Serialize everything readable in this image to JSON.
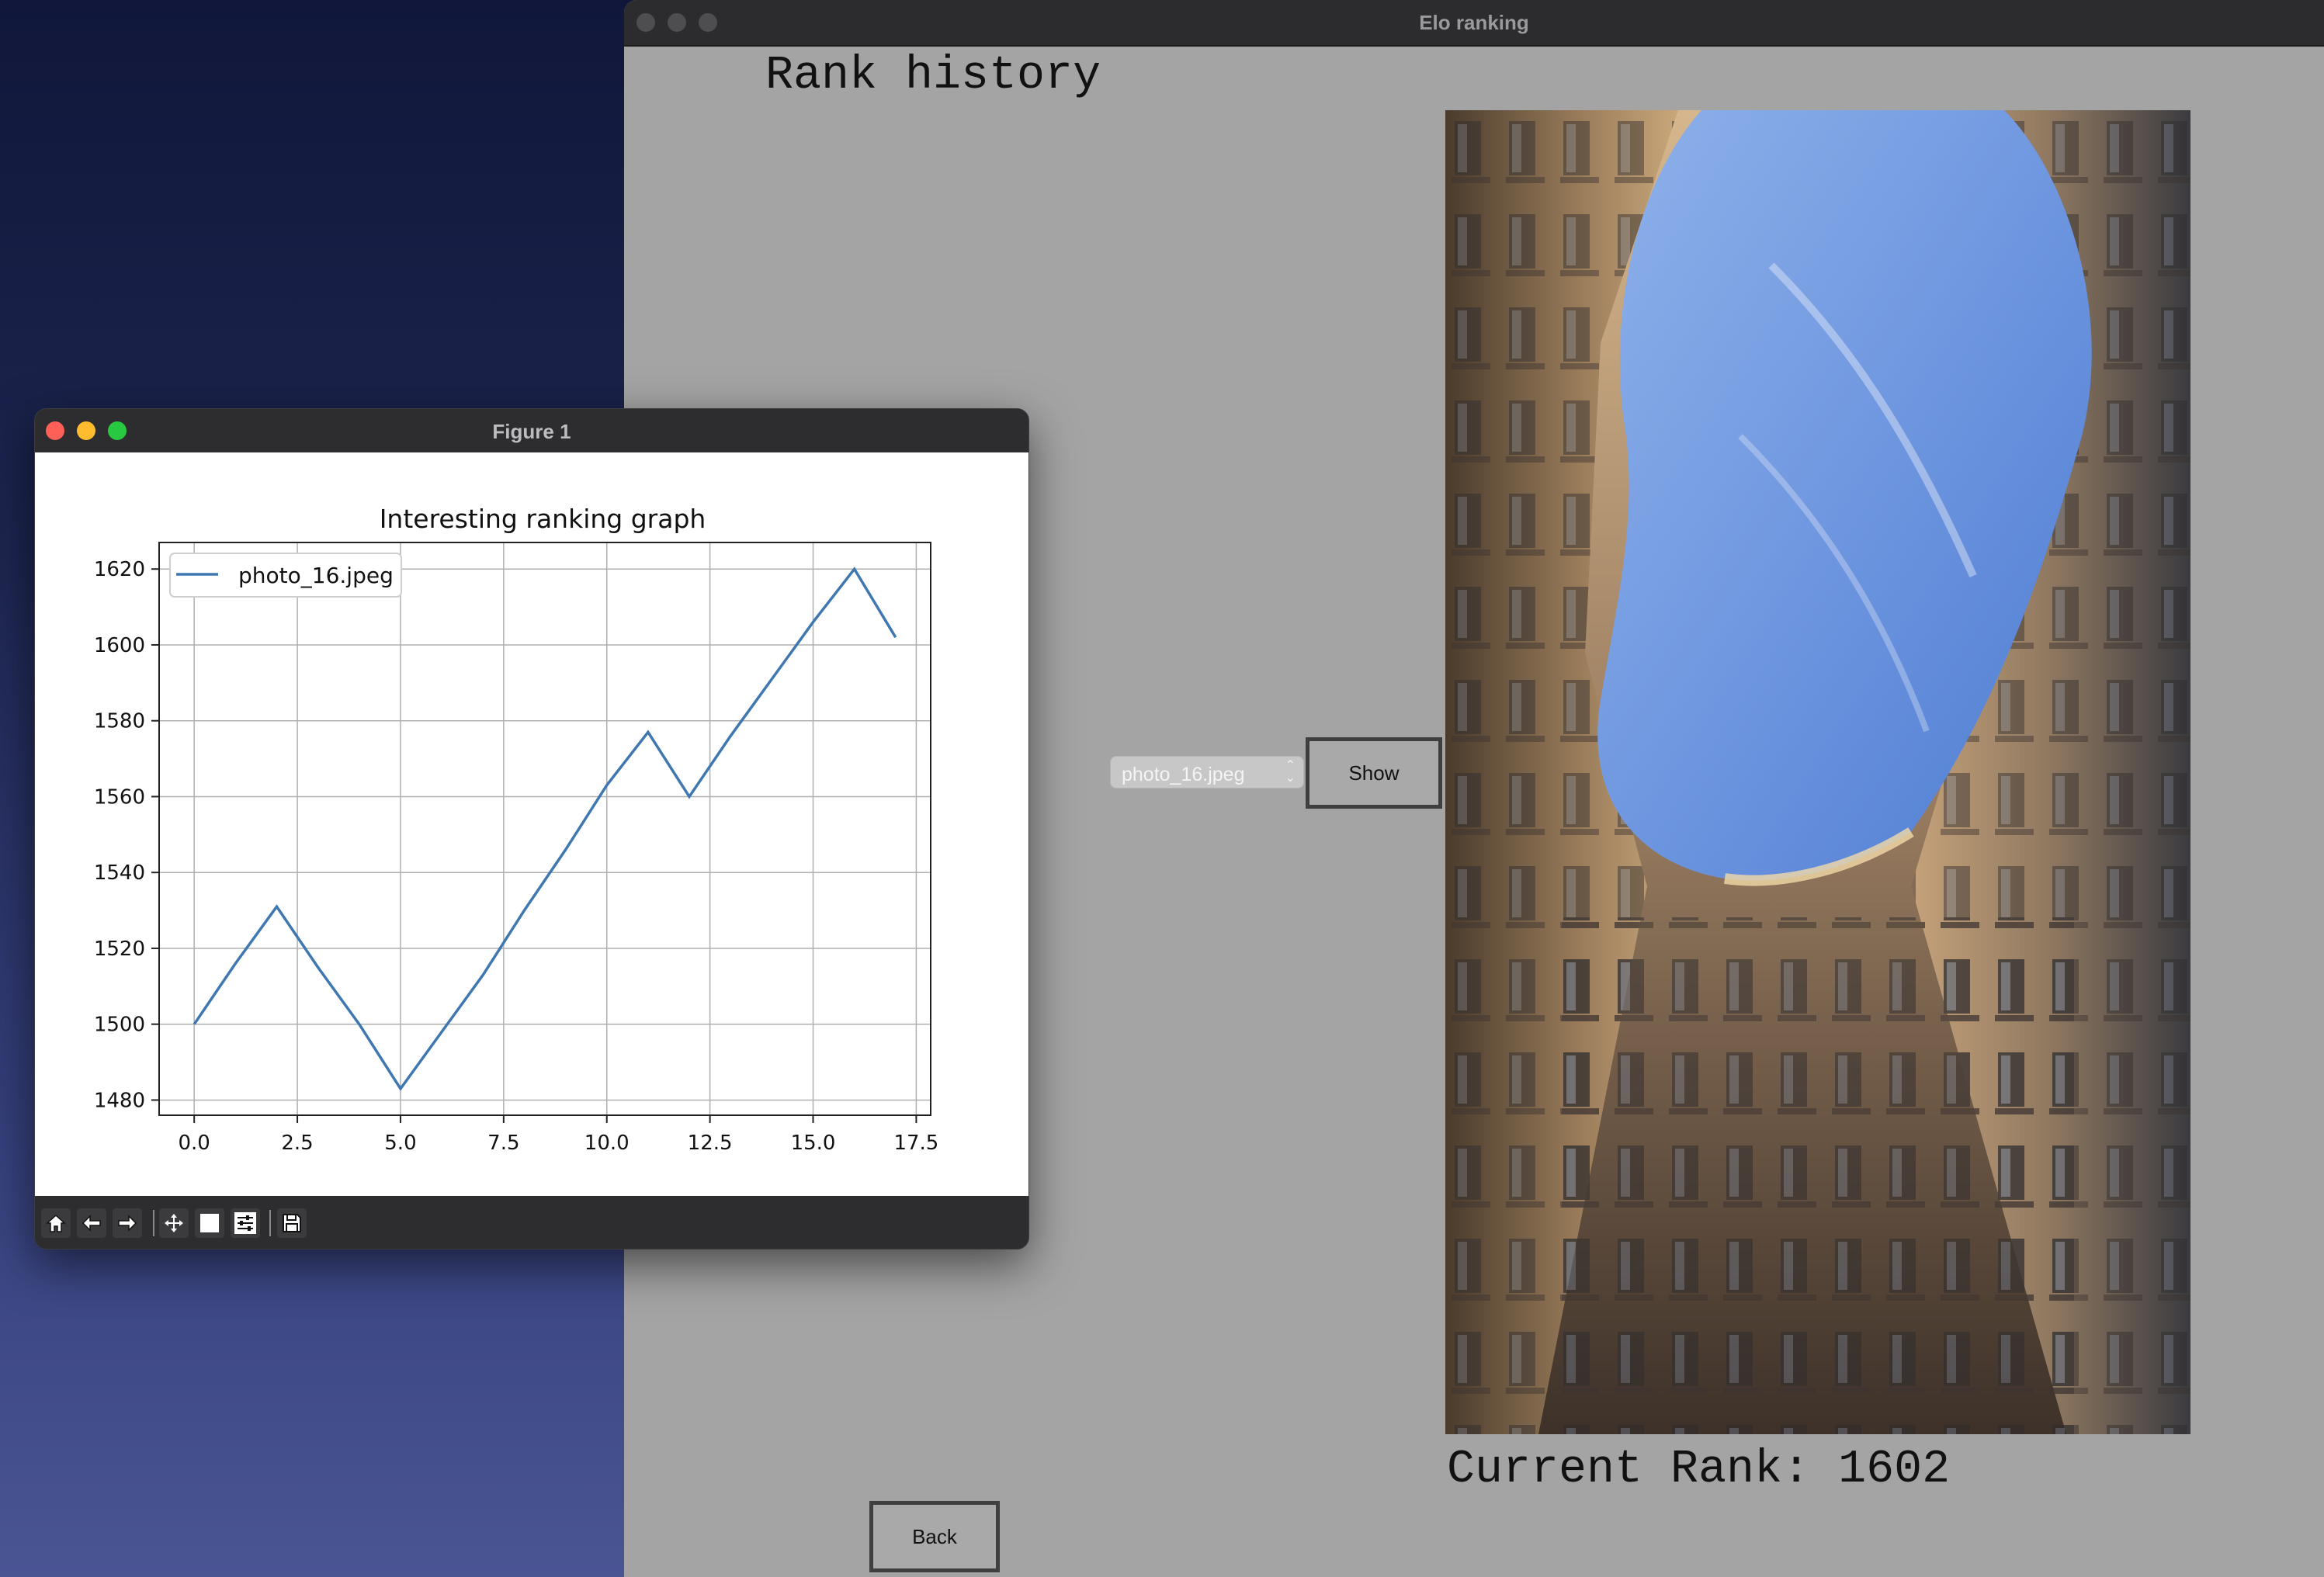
{
  "main_window": {
    "title": "Elo ranking",
    "heading": "Rank history",
    "photo_select": {
      "value": "photo_16.jpeg"
    },
    "show_button": "Show",
    "back_button": "Back",
    "current_rank": "Current Rank: 1602"
  },
  "figure_window": {
    "title": "Figure 1",
    "toolbar": [
      "home-icon",
      "back-arrow-icon",
      "forward-arrow-icon",
      "pan-icon",
      "zoom-icon",
      "configure-subplots-icon",
      "save-icon"
    ]
  },
  "chart_data": {
    "type": "line",
    "title": "Interesting ranking graph",
    "xlabel": "",
    "ylabel": "",
    "xlim": [
      -0.85,
      17.85
    ],
    "ylim": [
      1476,
      1627
    ],
    "x_ticks": [
      "0.0",
      "2.5",
      "5.0",
      "7.5",
      "10.0",
      "12.5",
      "15.0",
      "17.5"
    ],
    "y_ticks": [
      "1480",
      "1500",
      "1520",
      "1540",
      "1560",
      "1580",
      "1600",
      "1620"
    ],
    "grid": true,
    "legend": "top-left",
    "series": [
      {
        "name": "photo_16.jpeg",
        "color": "#3f77b0",
        "x": [
          0,
          1,
          2,
          3,
          4,
          5,
          6,
          7,
          8,
          9,
          10,
          11,
          12,
          13,
          14,
          15,
          16,
          17
        ],
        "y": [
          1500,
          1516,
          1531,
          1515,
          1500,
          1483,
          1498,
          1513,
          1530,
          1546,
          1563,
          1577,
          1560,
          1576,
          1591,
          1606,
          1620,
          1602
        ]
      }
    ]
  }
}
